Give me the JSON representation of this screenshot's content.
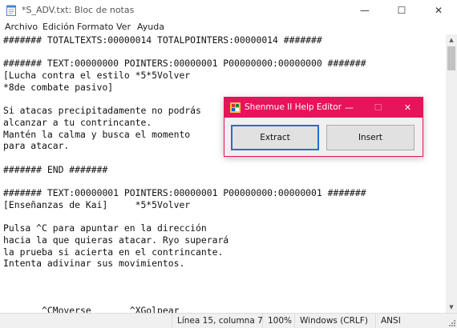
{
  "window": {
    "title": "*S_ADV.txt: Bloc de notas",
    "controls": {
      "minimize": "—",
      "maximize": "☐",
      "close": "✕"
    }
  },
  "menu": [
    "Archivo",
    "Edición",
    "Formato",
    "Ver",
    "Ayuda"
  ],
  "document": {
    "lines": [
      "####### TOTALTEXTS:00000014 TOTALPOINTERS:00000014 #######",
      "",
      "####### TEXT:00000000 POINTERS:00000001 P00000000:00000000 #######",
      "[Lucha contra el estilo *5*5Volver",
      "*8de combate pasivo]",
      "",
      "Si atacas precipitadamente no podrás",
      "alcanzar a tu contrincante.",
      "Mantén la calma y busca el momento",
      "para atacar.",
      "",
      "####### END #######",
      "",
      "####### TEXT:00000001 POINTERS:00000001 P00000000:00000001 #######",
      "[Enseñanzas de Kai]     *5*5Volver",
      "",
      "Pulsa ^C para apuntar en la dirección",
      "hacia la que quieras atacar. Ryo superará",
      "la prueba si acierta en el contrincante.",
      "Intenta adivinar sus movimientos.",
      "",
      "",
      "",
      "       ^CMoverse       ^XGolpear"
    ]
  },
  "status_bar": {
    "position": "Línea 15, columna 7",
    "zoom": "100%",
    "line_ending": "Windows (CRLF)",
    "encoding": "ANSI"
  },
  "dialog": {
    "title": "Shenmue II Help Editor",
    "controls": {
      "minimize": "—",
      "maximize": "☐",
      "close": "✕"
    },
    "buttons": {
      "extract": "Extract",
      "insert": "Insert"
    },
    "accent_color": "#e5145b"
  },
  "colors": {
    "dialog_titlebar": "#e5145b",
    "default_button_border": "#1f6fd6",
    "statusbar_bg": "#f0f0f0"
  }
}
